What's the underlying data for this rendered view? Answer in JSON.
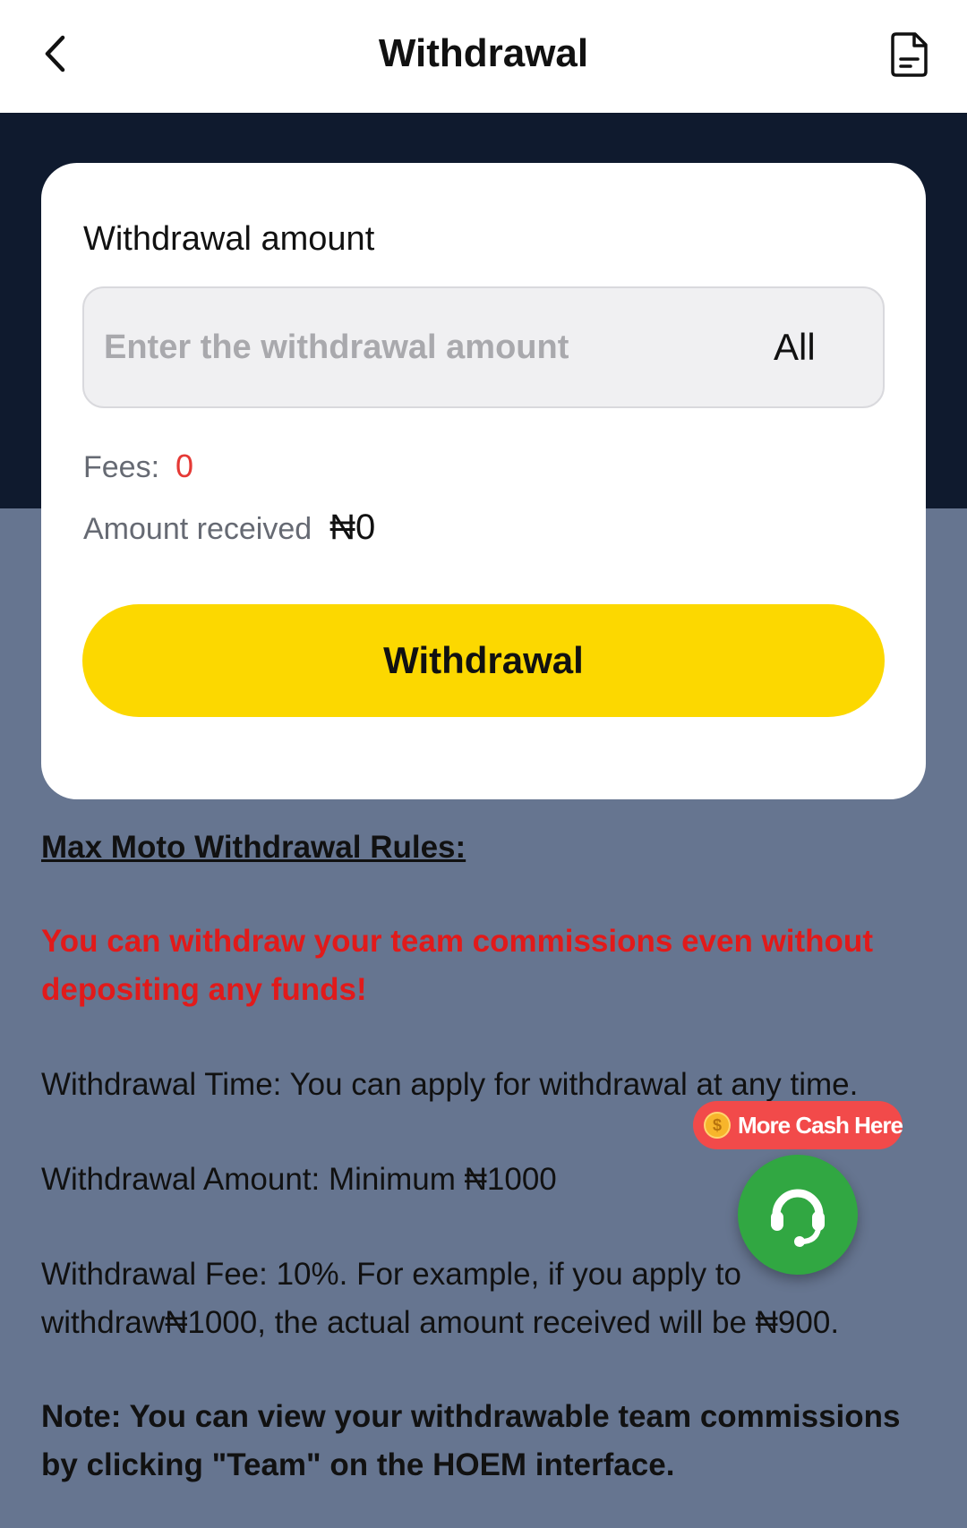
{
  "header": {
    "title": "Withdrawal",
    "back_icon": "chevron-left-icon",
    "records_icon": "document-icon"
  },
  "form": {
    "amount_label": "Withdrawal amount",
    "amount_placeholder": "Enter the withdrawal amount",
    "amount_value": "",
    "all_label": "All",
    "fees_label": "Fees:",
    "fees_value": "0",
    "received_label": "Amount received",
    "received_value": "₦0",
    "submit_label": "Withdrawal"
  },
  "rules": {
    "title": "Max Moto Withdrawal Rules:",
    "highlight": "You can withdraw your team commissions even without depositing any funds!",
    "time": "Withdrawal Time: You can apply for withdrawal at any time.",
    "amount": "Withdrawal Amount: Minimum ₦1000",
    "fee": "Withdrawal Fee: 10%. For example, if you apply to withdraw₦1000, the actual amount received will be ₦900.",
    "note": "Note: You can view your withdrawable team commissions by clicking \"Team\" on the HOEM interface."
  },
  "promo": {
    "label": "More Cash Here",
    "coin_symbol": "$"
  },
  "support": {
    "icon": "headset-icon"
  },
  "colors": {
    "dark_band": "#0f1a2e",
    "background": "#667590",
    "accent_button": "#fcd800",
    "highlight_text": "#e11a1a",
    "fees_value": "#e53935",
    "support_fab": "#31a742",
    "promo_badge": "#f24a4a"
  }
}
